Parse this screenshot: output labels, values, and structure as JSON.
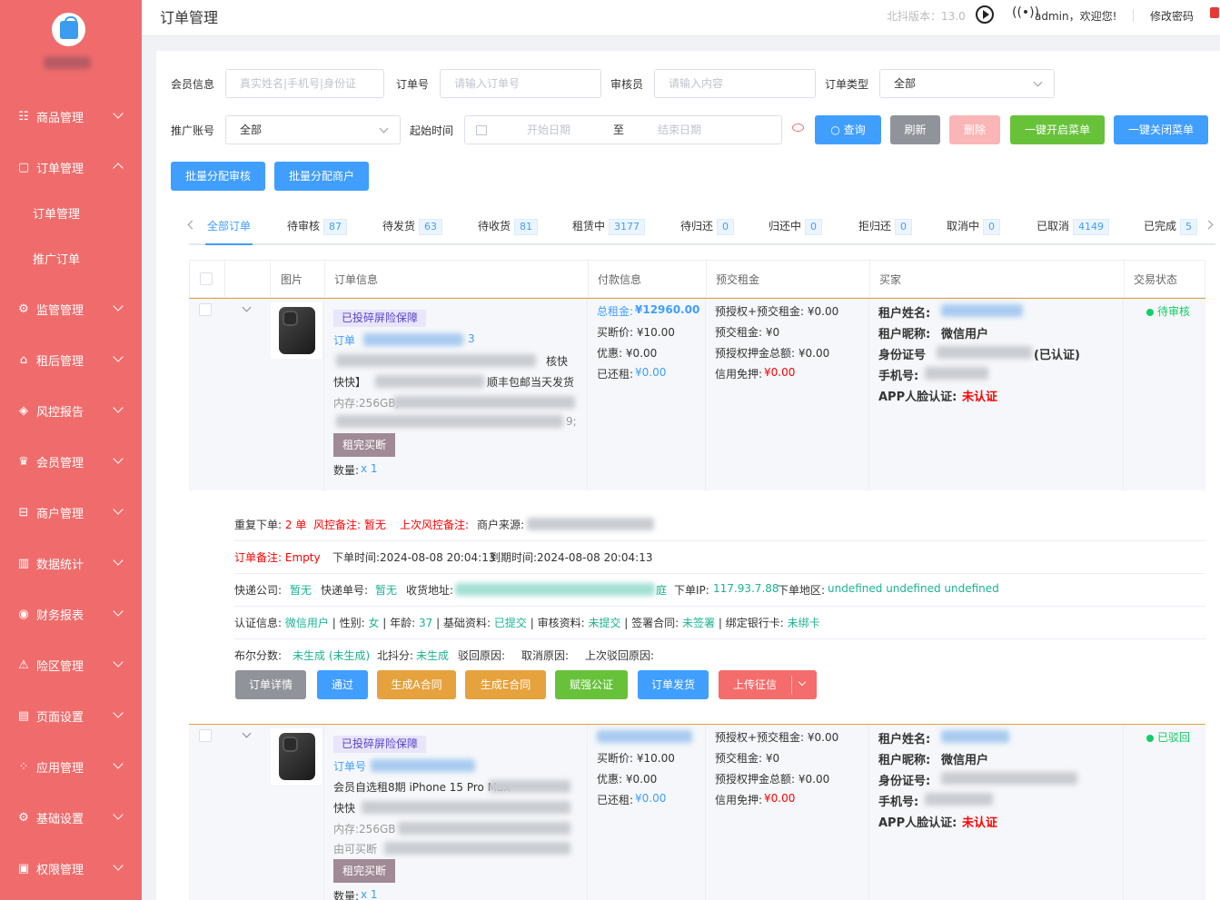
{
  "sidebar": {
    "menu": [
      {
        "label": "商品管理",
        "icon": "grid-list-icon"
      },
      {
        "label": "订单管理",
        "icon": "order-doc-icon"
      },
      {
        "label": "监管管理",
        "icon": "gear-icon"
      },
      {
        "label": "租后管理",
        "icon": "house-icon"
      },
      {
        "label": "风控报告",
        "icon": "cube-icon"
      },
      {
        "label": "会员管理",
        "icon": "crown-icon"
      },
      {
        "label": "商户管理",
        "icon": "store-icon"
      },
      {
        "label": "数据统计",
        "icon": "bar-chart-icon"
      },
      {
        "label": "财务报表",
        "icon": "wallet-icon"
      },
      {
        "label": "险区管理",
        "icon": "warning-icon"
      },
      {
        "label": "页面设置",
        "icon": "layout-icon"
      },
      {
        "label": "应用管理",
        "icon": "apps-icon"
      },
      {
        "label": "基础设置",
        "icon": "gear-icon"
      },
      {
        "label": "权限管理",
        "icon": "lock-icon"
      }
    ],
    "submenu": [
      "订单管理",
      "推广订单"
    ]
  },
  "header": {
    "title": "订单管理",
    "version": "北抖版本：13.0",
    "welcome": "admin，欢迎您!",
    "change_password": "修改密码"
  },
  "filters": {
    "member_label": "会员信息",
    "member_placeholder": "真实姓名|手机号|身份证",
    "order_no_label": "订单号",
    "order_no_placeholder": "请输入订单号",
    "reviewer_label": "审核员",
    "reviewer_placeholder": "请输入内容",
    "order_type_label": "订单类型",
    "order_type_value": "全部",
    "promo_label": "推广账号",
    "promo_value": "全部",
    "start_label": "起始时间",
    "start_placeholder": "开始日期",
    "range_sep": "至",
    "end_placeholder": "结束日期"
  },
  "buttons": {
    "query": "查询",
    "refresh": "刷新",
    "delete": "删除",
    "open_menu": "一键开启菜单",
    "close_menu": "一键关闭菜单",
    "batch_reviewer": "批量分配审核",
    "batch_merchant": "批量分配商户"
  },
  "tabs": [
    {
      "label": "全部订单",
      "count": ""
    },
    {
      "label": "待审核",
      "count": "87"
    },
    {
      "label": "待发货",
      "count": "63"
    },
    {
      "label": "待收货",
      "count": "81"
    },
    {
      "label": "租赁中",
      "count": "3177"
    },
    {
      "label": "待归还",
      "count": "0"
    },
    {
      "label": "归还中",
      "count": "0"
    },
    {
      "label": "拒归还",
      "count": "0"
    },
    {
      "label": "取消中",
      "count": "0"
    },
    {
      "label": "已取消",
      "count": "4149"
    },
    {
      "label": "已完成",
      "count": "5"
    }
  ],
  "table": {
    "headers": [
      "图片",
      "订单信息",
      "付款信息",
      "预交租金",
      "买家",
      "交易状态"
    ]
  },
  "orders": [
    {
      "tag": "已投碎屏险保障",
      "order_no_prefix": "订单",
      "order_no_suffix": "3",
      "title_tail": "核快",
      "title_line2": "快快】",
      "title_line2_tail": "顺丰包邮当天发货",
      "spec": "内存:256GB;",
      "spec_tail": "9;",
      "buyout": "租完买断",
      "qty_label": "数量:",
      "qty": "x 1",
      "total_rent_label": "总租金:",
      "total_rent": "¥12960.00",
      "buyout_price": "买断价: ¥10.00",
      "discount": "优惠: ¥0.00",
      "repaid_label": "已还租:",
      "repaid": "¥0.00",
      "preauth": "预授权+预交租金: ¥0.00",
      "prepaid_rent": "预交租金: ¥0",
      "preauth_deposit": "预授权押金总额: ¥0.00",
      "credit_free_label": "信用免押:",
      "credit_free": "¥0.00",
      "renter_name_label": "租户姓名:",
      "renter_nick_label": "租户昵称:",
      "renter_nick": "微信用户",
      "id_label": "身份证号",
      "id_verified": "(已认证)",
      "phone_label": "手机号:",
      "face_label": "APP人脸认证:",
      "face_value": "未认证",
      "status": "待审核"
    },
    {
      "tag": "已投碎屏险保障",
      "order_no_prefix": "订单号",
      "title_line1": "会员自选租8期 iPhone 15 Pro Max",
      "title_line2": "快快",
      "spec": "内存:256GB",
      "spec_line2": "由可买断",
      "buyout": "租完买断",
      "qty_label": "数量:",
      "qty": "x 1",
      "buyout_price": "买断价: ¥10.00",
      "discount": "优惠: ¥0.00",
      "repaid_label": "已还租:",
      "repaid": "¥0.00",
      "preauth": "预授权+预交租金: ¥0.00",
      "prepaid_rent": "预交租金: ¥0",
      "preauth_deposit": "预授权押金总额: ¥0.00",
      "credit_free_label": "信用免押:",
      "credit_free": "¥0.00",
      "renter_name_label": "租户姓名:",
      "renter_nick_label": "租户昵称:",
      "renter_nick": "微信用户",
      "id_label": "身份证号:",
      "phone_label": "手机号:",
      "face_label": "APP人脸认证:",
      "face_value": "未认证",
      "status": "已驳回"
    }
  ],
  "detail": {
    "repeat_label": "重复下单:",
    "repeat_value": "2 单",
    "risk_label": "风控备注:",
    "risk_value": "暂无",
    "last_risk_label": "上次风控备注:",
    "merchant_source": "商户来源:",
    "note_label": "订单备注:",
    "note_value": "Empty",
    "order_time": "下单时间:2024-08-08 20:04:13",
    "expire_time": "到期时间:2024-08-08 20:04:13",
    "courier_label": "快递公司:",
    "courier_value": "暂无",
    "tracking_label": "快递单号:",
    "tracking_value": "暂无",
    "address_label": "收货地址:",
    "address_tail": "庭",
    "ip_label": "下单IP:",
    "ip_value": "117.93.7.88",
    "region_label": "下单地区:",
    "region_value": "undefined undefined undefined",
    "auth_label": "认证信息:",
    "auth_value": "微信用户",
    "gender_label": "| 性别:",
    "gender_value": "女",
    "age_label": "| 年龄:",
    "age_value": "37",
    "basic_label": "| 基础资料:",
    "basic_value": "已提交",
    "review_label": "| 审核资料:",
    "review_value": "未提交",
    "contract_label": "| 签署合同:",
    "contract_value": "未签署",
    "bank_label": "| 绑定银行卡:",
    "bank_value": "未绑卡",
    "bool_label": "布尔分数:",
    "bool_value": "未生成 (未生成)",
    "beidou_label": "北抖分:",
    "beidou_value": "未生成",
    "reject_label": "驳回原因:",
    "cancel_label": "取消原因:",
    "last_reject_label": "上次驳回原因:"
  },
  "actions": {
    "detail": "订单详情",
    "pass": "通过",
    "gen_a": "生成A合同",
    "gen_e": "生成E合同",
    "notary": "赋强公证",
    "ship": "订单发货",
    "upload": "上传征信"
  },
  "colors": {
    "sidebar": "#f06c6c",
    "primary": "#409eff",
    "success": "#67c23a",
    "warning": "#e6a23c",
    "danger": "#f56c6c"
  }
}
